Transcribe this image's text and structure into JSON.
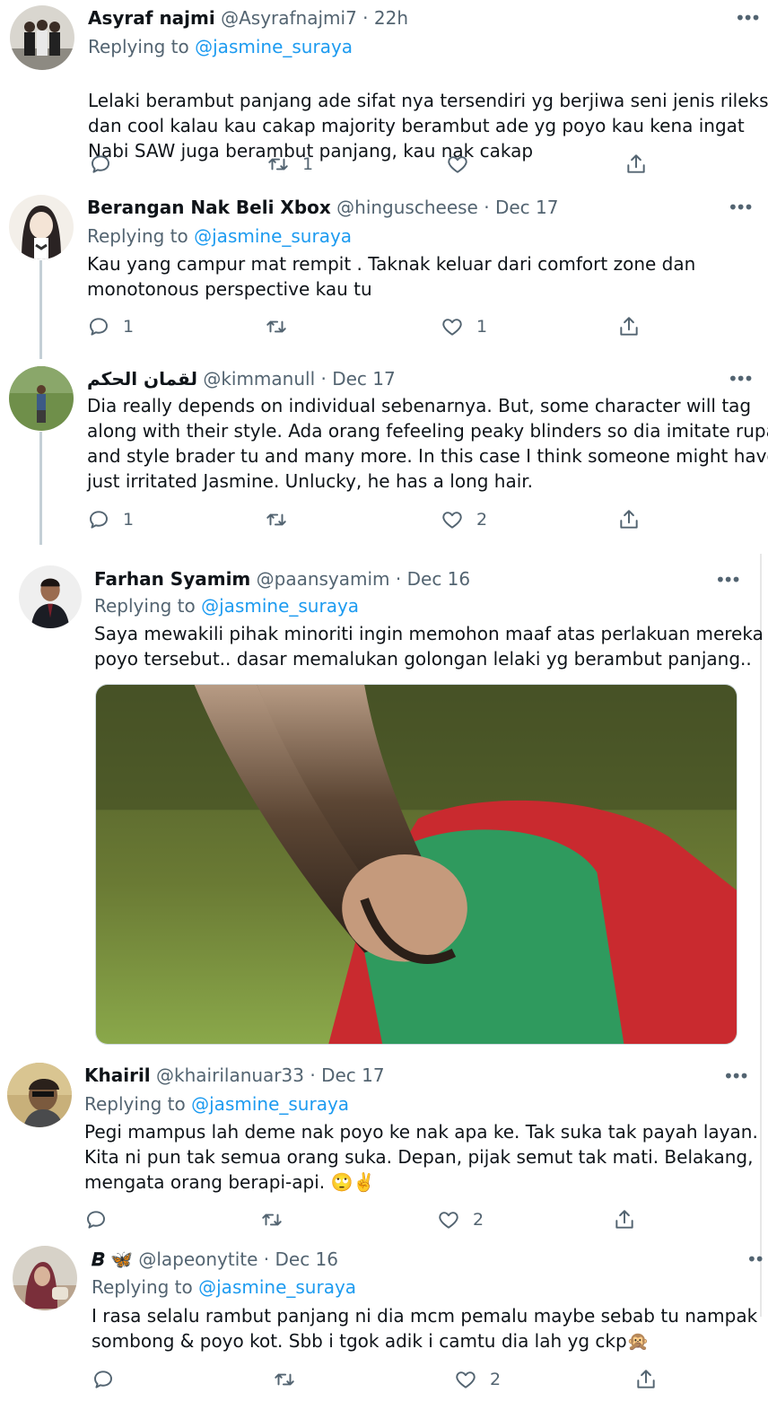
{
  "tweets": [
    {
      "name": "Asyraf najmi",
      "handle": "@Asyrafnajmi7",
      "time": "22h",
      "replying_label": "Replying to",
      "replying_to": "@jasmine_suraya",
      "lines": [
        "Lelaki berambut panjang ade sifat nya tersendiri yg berjiwa seni jenis rileks",
        "dan cool kalau kau cakap majority berambut ade yg poyo kau kena ingat",
        "Nabi SAW juga berambut panjang, kau nak cakap"
      ],
      "replies": "",
      "retweets": "1",
      "likes": ""
    },
    {
      "name": "Berangan Nak Beli Xbox",
      "handle": "@hinguscheese",
      "time": "Dec 17",
      "replying_label": "Replying to",
      "replying_to": "@jasmine_suraya",
      "lines": [
        "Kau yang campur mat rempit . Taknak keluar dari comfort zone dan",
        "monotonous perspective kau tu"
      ],
      "replies": "1",
      "retweets": "",
      "likes": "1"
    },
    {
      "name": "لقمان الحكم",
      "handle": "@kimmanull",
      "time": "Dec 17",
      "lines": [
        "Dia really depends on individual sebenarnya. But, some character will tag",
        "along with their style. Ada orang fefeeling peaky blinders so dia imitate rupa",
        "and style brader tu and many more. In this case I think someone might have",
        "just irritated Jasmine. Unlucky, he has a long hair."
      ],
      "replies": "1",
      "retweets": "",
      "likes": "2"
    },
    {
      "name": "Farhan Syamim",
      "handle": "@paansyamim",
      "time": "Dec 16",
      "replying_label": "Replying to",
      "replying_to": "@jasmine_suraya",
      "lines": [
        "Saya mewakili pihak minoriti ingin memohon maaf atas perlakuan mereka yg",
        "poyo tersebut.. dasar memalukan golongan lelaki yg berambut panjang.."
      ]
    },
    {
      "name": "Khairil",
      "handle": "@khairilanuar33",
      "time": "Dec 17",
      "replying_label": "Replying to",
      "replying_to": "@jasmine_suraya",
      "lines": [
        "Pegi mampus lah deme nak poyo ke nak apa ke. Tak suka tak payah layan.",
        "Kita ni pun tak semua orang suka. Depan, pijak semut tak mati. Belakang,",
        "mengata orang berapi-api. 🙄✌️"
      ],
      "replies": "",
      "retweets": "",
      "likes": "2"
    },
    {
      "name": "𝑩 🦋",
      "handle": "@lapeonytite",
      "time": "Dec 16",
      "replying_label": "Replying to",
      "replying_to": "@jasmine_suraya",
      "lines": [
        "I rasa selalu rambut panjang ni dia mcm pemalu maybe sebab tu nampak",
        "sombong & poyo kot. Sbb i tgok adik i camtu dia lah yg ckp🙊"
      ],
      "replies": "",
      "retweets": "",
      "likes": "2"
    }
  ],
  "separator": "·",
  "icons": {
    "reply": "reply-icon",
    "retweet": "retweet-icon",
    "like": "heart-icon",
    "share": "share-icon",
    "more": "more-icon"
  },
  "colors": {
    "text": "#0f1419",
    "secondary": "#536471",
    "link": "#1d9bf0",
    "thread_line": "#c4cfd6"
  }
}
